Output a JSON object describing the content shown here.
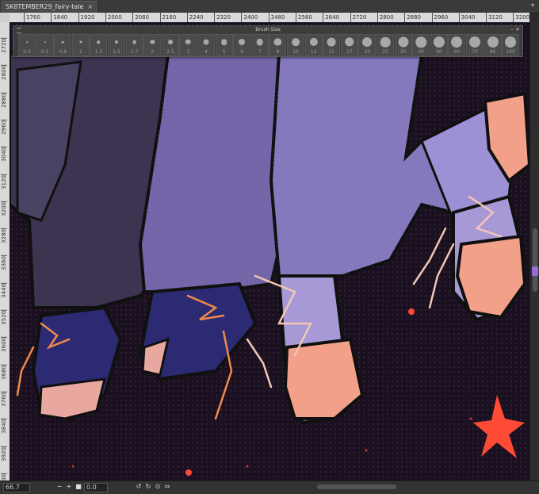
{
  "tab": {
    "title": "SK8TEMBER29_fairy-tale",
    "close": "×"
  },
  "tabbar_menu": "▾",
  "ruler": {
    "horizontal": [
      "1760",
      "1840",
      "1920",
      "2000",
      "2080",
      "2160",
      "2240",
      "2320",
      "2400",
      "2480",
      "2560",
      "2640",
      "2720",
      "2800",
      "2880",
      "2960",
      "3040",
      "3120",
      "3200"
    ],
    "vertical": [
      "2720",
      "2800",
      "2880",
      "2960",
      "3040",
      "3120",
      "3200",
      "3280",
      "3360",
      "3440",
      "3520",
      "3600",
      "3680",
      "3760",
      "3840",
      "3920",
      "4000"
    ]
  },
  "brush_panel": {
    "title": "Brush Size",
    "buttons": "–  ×",
    "sizes": [
      "0.3",
      "0.5",
      "0.8",
      "1",
      "1.2",
      "1.5",
      "1.7",
      "2",
      "2.5",
      "3",
      "4",
      "5",
      "6",
      "7",
      "8",
      "10",
      "12",
      "15",
      "17",
      "20",
      "25",
      "30",
      "40",
      "50",
      "60",
      "70",
      "80",
      "100"
    ]
  },
  "statusbar": {
    "zoom": "66.7",
    "angle": "0.0",
    "minus": "−",
    "plus": "+",
    "fit": "■",
    "rotate_left": "↺",
    "rotate_right": "↻",
    "reset": "⊙",
    "flip": "⇔"
  },
  "colors": {
    "background": "#1a1020",
    "trousers": "#7465a8",
    "dark_coat": "#3c3450",
    "shoe_pink": "#f2a08a",
    "shoe_navy": "#2b2a72",
    "star": "#ff4a36"
  }
}
